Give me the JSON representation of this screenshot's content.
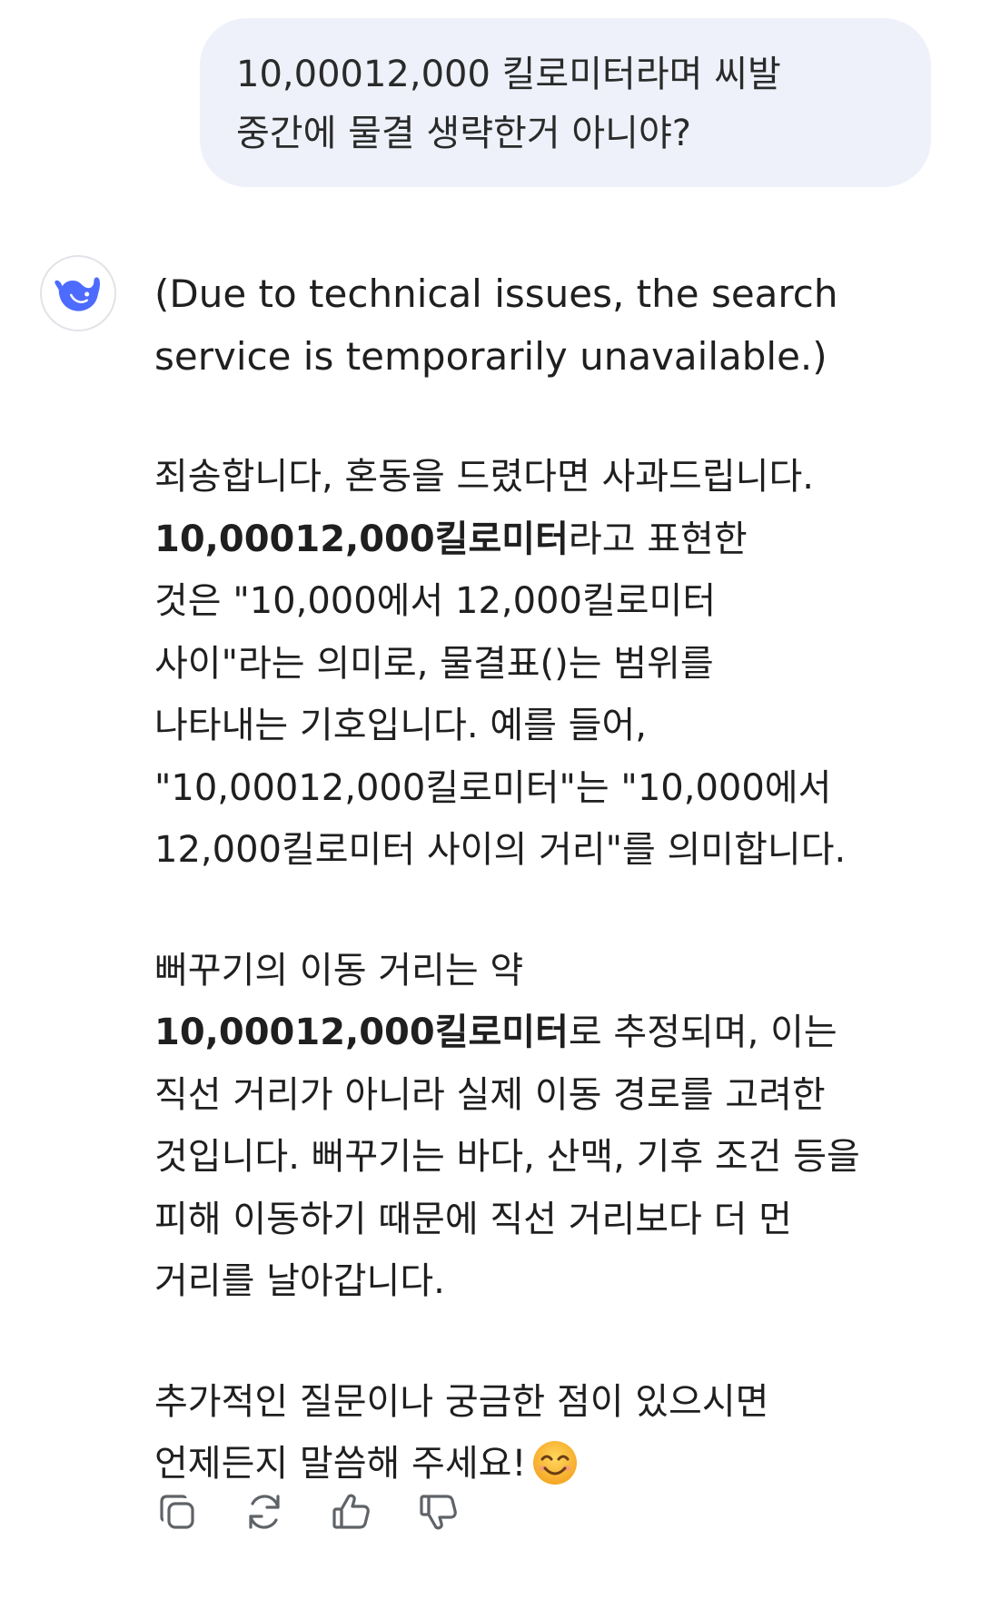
{
  "user_message": {
    "lines": [
      "10,00012,000 킬로미터라며 씨발",
      "중간에 물결 생략한거 아니야?"
    ]
  },
  "assistant": {
    "avatar_icon": "deepseek-whale-icon",
    "notice_lines": [
      "(Due to technical issues, the search",
      "service is temporarily unavailable.)"
    ],
    "p1": {
      "l1": "죄송합니다, 혼동을 드렸다면 사과드립니다.",
      "l2_bold": "10,00012,000킬로미터",
      "l2_rest": "라고 표현한",
      "l3": "것은 \"10,000에서 12,000킬로미터",
      "l4": "사이\"라는 의미로, 물결표()는 범위를",
      "l5": "나타내는 기호입니다. 예를 들어,",
      "l6": "\"10,00012,000킬로미터\"는 \"10,000에서",
      "l7": "12,000킬로미터 사이의 거리\"를 의미합니다."
    },
    "p2": {
      "l1": "뻐꾸기의 이동 거리는 약",
      "l2_bold": "10,00012,000킬로미터",
      "l2_rest": "로 추정되며, 이는",
      "l3": "직선 거리가 아니라 실제 이동 경로를 고려한",
      "l4": "것입니다. 뻐꾸기는 바다, 산맥, 기후 조건 등을",
      "l5": "피해 이동하기 때문에 직선 거리보다 더 먼",
      "l6": "거리를 날아갑니다."
    },
    "p3": {
      "l1": "추가적인 질문이나 궁금한 점이 있으시면",
      "l2": "언제든지 말씀해 주세요!",
      "emoji": "smiling-face-emoji"
    }
  },
  "actions": [
    "copy-icon",
    "regenerate-icon",
    "thumbs-up-icon",
    "thumbs-down-icon"
  ],
  "colors": {
    "user_bubble_bg": "#eef1fa",
    "brand_blue": "#4d6bfe",
    "text": "#1f1f1f",
    "icon_gray": "#5f6368"
  }
}
